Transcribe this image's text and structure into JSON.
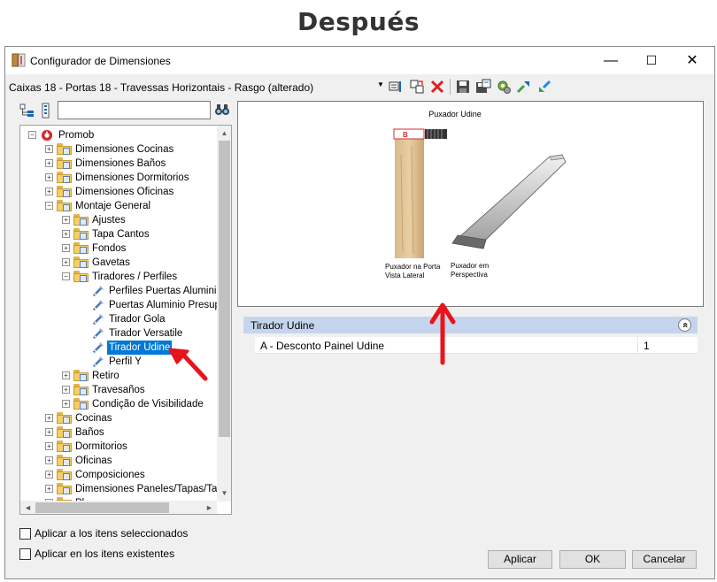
{
  "heading": "Después",
  "window": {
    "title": "Configurador de Dimensiones",
    "minimize": "—",
    "maximize": "☐",
    "close": "✕"
  },
  "combo": {
    "value": "Caixas 18 - Portas 18 - Travessas Horizontais - Rasgo (alterado)",
    "arrow": "▼"
  },
  "search": {
    "value": ""
  },
  "tree": {
    "items": [
      {
        "label": "Promob",
        "level": 0,
        "expander": "−",
        "icon": "promob-icon"
      },
      {
        "label": "Dimensiones Cocinas",
        "level": 1,
        "expander": "+",
        "icon": "folder-icon"
      },
      {
        "label": "Dimensiones Baños",
        "level": 1,
        "expander": "+",
        "icon": "folder-icon"
      },
      {
        "label": "Dimensiones Dormitorios",
        "level": 1,
        "expander": "+",
        "icon": "folder-icon"
      },
      {
        "label": "Dimensiones Oficinas",
        "level": 1,
        "expander": "+",
        "icon": "folder-icon"
      },
      {
        "label": "Montaje General",
        "level": 1,
        "expander": "−",
        "icon": "folder-icon"
      },
      {
        "label": "Ajustes",
        "level": 2,
        "expander": "+",
        "icon": "folder-icon"
      },
      {
        "label": "Tapa Cantos",
        "level": 2,
        "expander": "+",
        "icon": "folder-icon"
      },
      {
        "label": "Fondos",
        "level": 2,
        "expander": "+",
        "icon": "folder-icon"
      },
      {
        "label": "Gavetas",
        "level": 2,
        "expander": "+",
        "icon": "folder-icon"
      },
      {
        "label": "Tiradores / Perfiles",
        "level": 2,
        "expander": "−",
        "icon": "folder-icon"
      },
      {
        "label": "Perfiles Puertas Aluminio",
        "level": 3,
        "expander": "",
        "icon": "config-item-icon"
      },
      {
        "label": "Puertas Aluminio Presupu",
        "level": 3,
        "expander": "",
        "icon": "config-item-icon"
      },
      {
        "label": "Tirador Gola",
        "level": 3,
        "expander": "",
        "icon": "config-item-icon"
      },
      {
        "label": "Tirador Versatile",
        "level": 3,
        "expander": "",
        "icon": "config-item-icon"
      },
      {
        "label": "Tirador Udine",
        "level": 3,
        "expander": "",
        "icon": "config-item-icon",
        "selected": true
      },
      {
        "label": "Perfil Y",
        "level": 3,
        "expander": "",
        "icon": "config-item-icon"
      },
      {
        "label": "Retiro",
        "level": 2,
        "expander": "+",
        "icon": "folder-icon"
      },
      {
        "label": "Travesaños",
        "level": 2,
        "expander": "+",
        "icon": "folder-icon"
      },
      {
        "label": "Condição de Visibilidade",
        "level": 2,
        "expander": "+",
        "icon": "folder-icon"
      },
      {
        "label": "Cocinas",
        "level": 1,
        "expander": "+",
        "icon": "folder-icon"
      },
      {
        "label": "Baños",
        "level": 1,
        "expander": "+",
        "icon": "folder-icon"
      },
      {
        "label": "Dormitorios",
        "level": 1,
        "expander": "+",
        "icon": "folder-icon"
      },
      {
        "label": "Oficinas",
        "level": 1,
        "expander": "+",
        "icon": "folder-icon"
      },
      {
        "label": "Composiciones",
        "level": 1,
        "expander": "+",
        "icon": "folder-icon"
      },
      {
        "label": "Dimensiones Paneles/Tapas/Tar",
        "level": 1,
        "expander": "+",
        "icon": "folder-icon"
      },
      {
        "label": "Pl",
        "level": 1,
        "expander": "+",
        "icon": "folder-icon"
      }
    ]
  },
  "preview": {
    "title": "Puxador Udine",
    "mark_label": "B",
    "caption_left_1": "Puxador na Porta",
    "caption_left_2": "Vista Lateral",
    "caption_right_1": "Puxador em",
    "caption_right_2": "Perspectiva"
  },
  "properties": {
    "group_title": "Tirador Udine",
    "collapse_icon": "«",
    "rows": [
      {
        "name": "A - Desconto Painel Udine",
        "value": "1"
      }
    ]
  },
  "checkboxes": {
    "apply_selected": "Aplicar a los itens seleccionados",
    "apply_existing": "Aplicar en los itens existentes"
  },
  "buttons": {
    "apply": "Aplicar",
    "ok": "OK",
    "cancel": "Cancelar"
  },
  "scroll": {
    "up": "▲",
    "down": "▼",
    "left": "◄",
    "right": "►"
  },
  "colors": {
    "selection": "#0078d7",
    "annotation_arrow": "#e8141b",
    "group_header": "#c5d5ee"
  }
}
